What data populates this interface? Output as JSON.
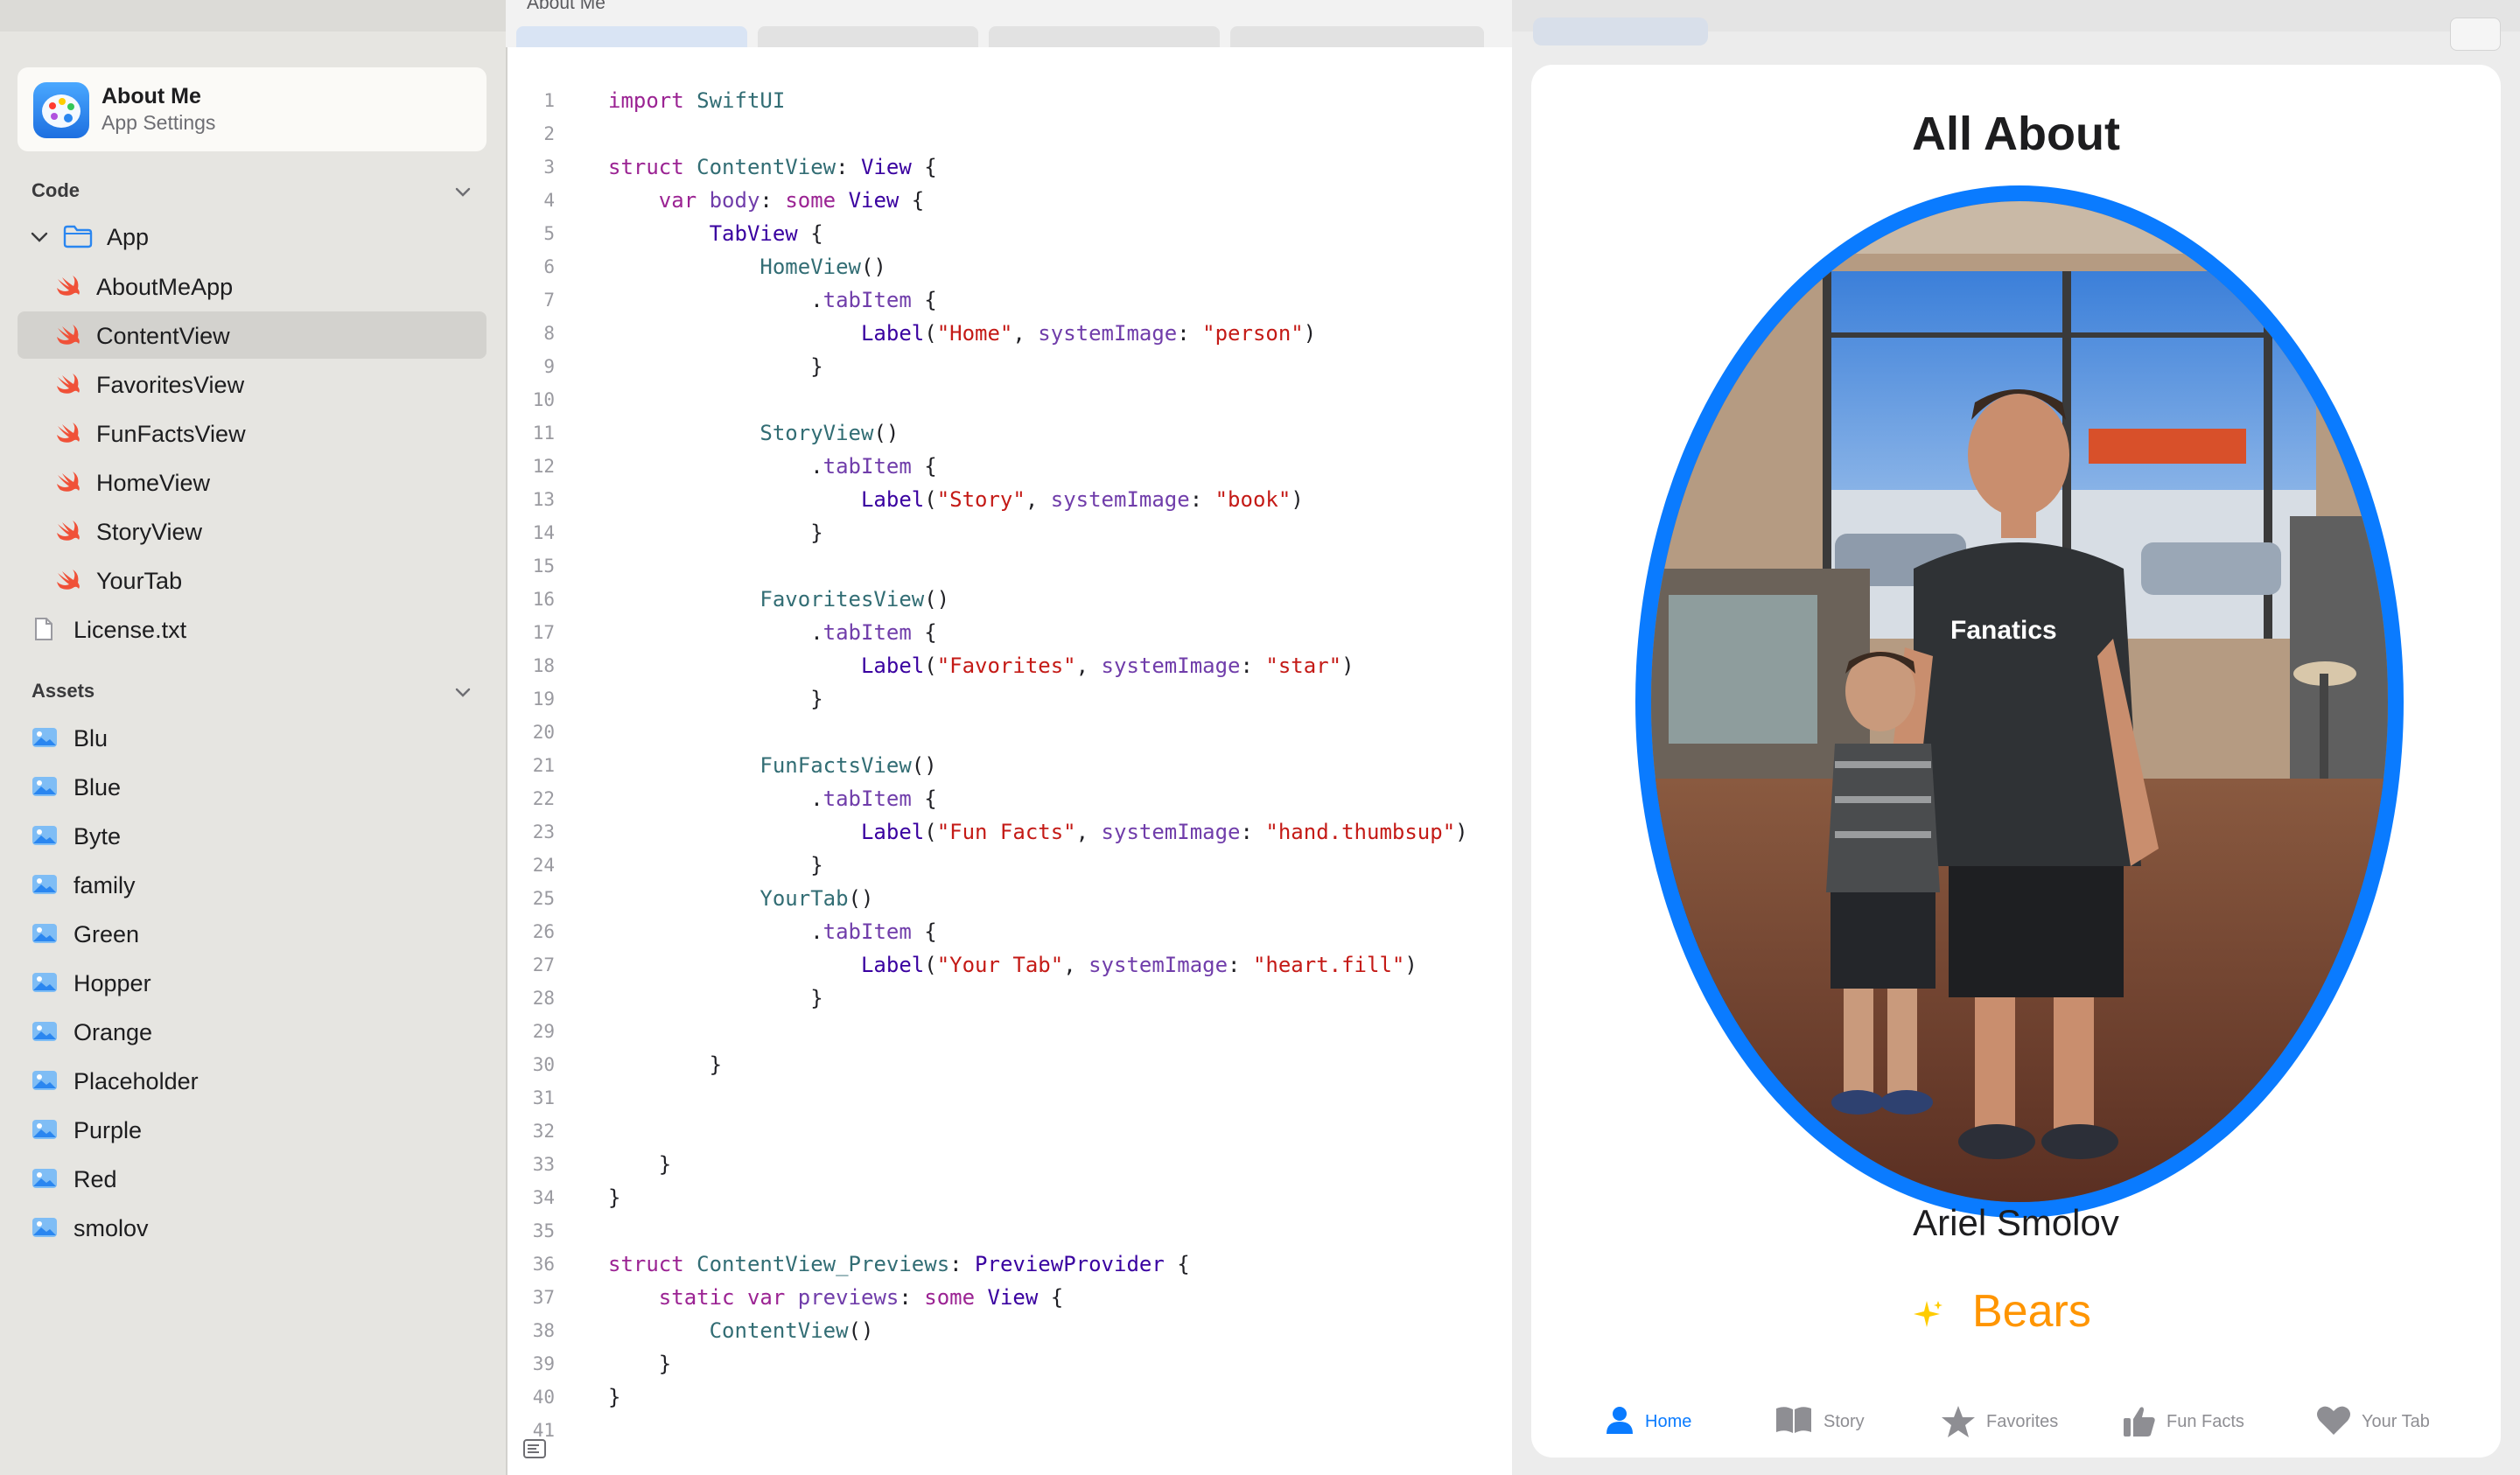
{
  "window": {
    "title": "About Me"
  },
  "project": {
    "name": "About Me",
    "subtitle": "App Settings"
  },
  "sidebar": {
    "code_header": "Code",
    "app_folder": "App",
    "code_files": [
      "AboutMeApp",
      "ContentView",
      "FavoritesView",
      "FunFactsView",
      "HomeView",
      "StoryView",
      "YourTab"
    ],
    "selected_file": "ContentView",
    "other_files": [
      "License.txt"
    ],
    "assets_header": "Assets",
    "assets": [
      "Blu",
      "Blue",
      "Byte",
      "family",
      "Green",
      "Hopper",
      "Orange",
      "Placeholder",
      "Purple",
      "Red",
      "smolov"
    ]
  },
  "editor": {
    "lines": [
      "import SwiftUI",
      "",
      "struct ContentView: View {",
      "    var body: some View {",
      "        TabView {",
      "            HomeView()",
      "                .tabItem {",
      "                    Label(\"Home\", systemImage: \"person\")",
      "                }",
      "",
      "            StoryView()",
      "                .tabItem {",
      "                    Label(\"Story\", systemImage: \"book\")",
      "                }",
      "",
      "            FavoritesView()",
      "                .tabItem {",
      "                    Label(\"Favorites\", systemImage: \"star\")",
      "                }",
      "",
      "            FunFactsView()",
      "                .tabItem {",
      "                    Label(\"Fun Facts\", systemImage: \"hand.thumbsup\")",
      "                }",
      "            YourTab()",
      "                .tabItem {",
      "                    Label(\"Your Tab\", systemImage: \"heart.fill\")",
      "                }",
      "",
      "        }",
      "",
      "",
      "    }",
      "}",
      "",
      "struct ContentView_Previews: PreviewProvider {",
      "    static var previews: some View {",
      "        ContentView()",
      "    }",
      "}",
      ""
    ],
    "line_numbers": [
      "1",
      "2",
      "3",
      "4",
      "5",
      "6",
      "7",
      "8",
      "9",
      "10",
      "11",
      "12",
      "13",
      "14",
      "15",
      "16",
      "17",
      "18",
      "19",
      "20",
      "21",
      "22",
      "23",
      "24",
      "25",
      "26",
      "27",
      "28",
      "29",
      "30",
      "31",
      "32",
      "33",
      "34",
      "35",
      "36",
      "37",
      "38",
      "39",
      "40",
      "41"
    ]
  },
  "preview": {
    "title": "All About",
    "name": "Ariel Smolov",
    "favorite": "Bears",
    "accent_color": "#0a7bff",
    "favorite_color": "#ff9500",
    "tabs": [
      {
        "label": "Home",
        "icon": "person-icon",
        "active": true
      },
      {
        "label": "Story",
        "icon": "book-icon",
        "active": false
      },
      {
        "label": "Favorites",
        "icon": "star-icon",
        "active": false
      },
      {
        "label": "Fun Facts",
        "icon": "thumbsup-icon",
        "active": false
      },
      {
        "label": "Your Tab",
        "icon": "heart-icon",
        "active": false
      }
    ]
  }
}
